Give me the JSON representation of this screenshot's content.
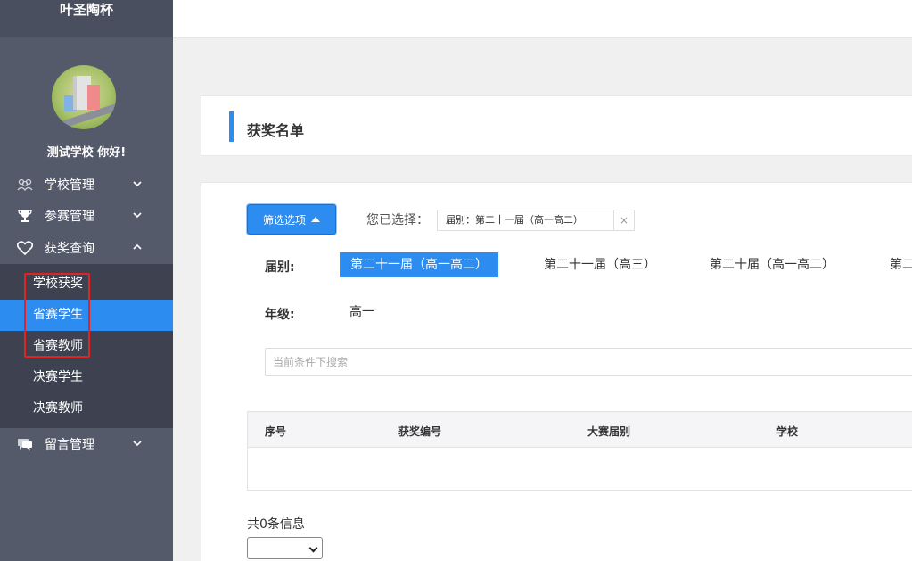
{
  "sidebar": {
    "brand": "叶圣陶杯",
    "greeting": "测试学校 你好!",
    "menu": [
      {
        "label": "学校管理",
        "icon": "group-icon"
      },
      {
        "label": "参赛管理",
        "icon": "trophy-icon"
      },
      {
        "label": "获奖查询",
        "icon": "heart-icon"
      },
      {
        "label": "留言管理",
        "icon": "chat-icon"
      }
    ],
    "submenu": [
      {
        "label": "学校获奖"
      },
      {
        "label": "省赛学生"
      },
      {
        "label": "省赛教师"
      },
      {
        "label": "决赛学生"
      },
      {
        "label": "决赛教师"
      }
    ]
  },
  "page": {
    "title": "获奖名单"
  },
  "filter": {
    "button_label": "筛选选项",
    "selected_label": "您已选择：",
    "tag_text": "届别：第二十一届（高一高二）",
    "tag_close": "×",
    "session_label": "届别:",
    "session_options": [
      "第二十一届（高一高二）",
      "第二十一届（高三）",
      "第二十届（高一高二）",
      "第二"
    ],
    "grade_label": "年级:",
    "grade_options": [
      "高一"
    ],
    "search_placeholder": "当前条件下搜索"
  },
  "table": {
    "columns": [
      "序号",
      "获奖编号",
      "大赛届别",
      "学校"
    ]
  },
  "footer": {
    "count_text": "共0条信息"
  },
  "colors": {
    "sidebar_bg": "#555a6b",
    "accent": "#2d8cf0",
    "highlight_box": "#e02424"
  }
}
